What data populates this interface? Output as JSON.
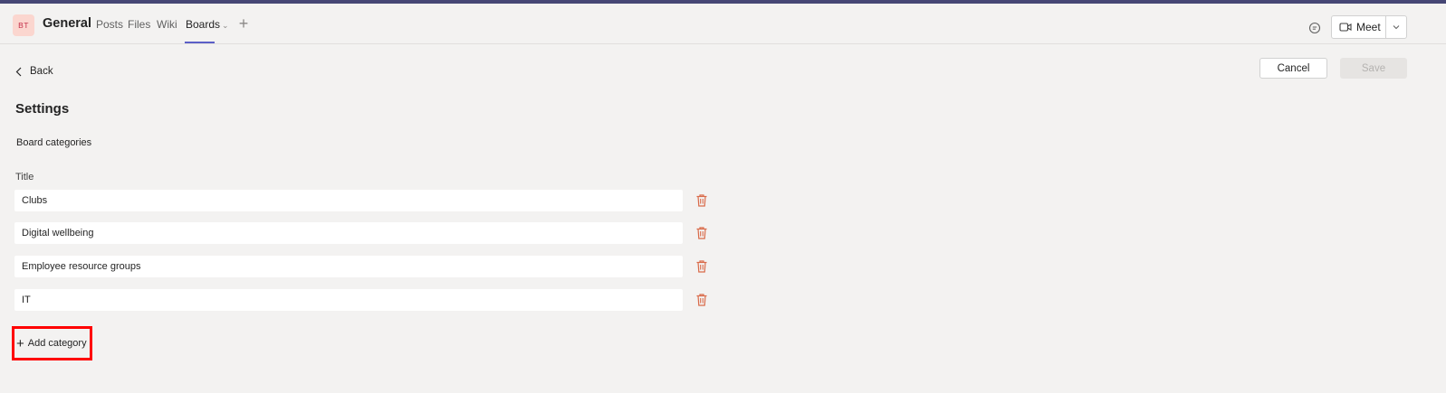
{
  "header": {
    "avatar_initials": "BT",
    "channel_title": "General",
    "tabs": [
      {
        "label": "Posts"
      },
      {
        "label": "Files"
      },
      {
        "label": "Wiki"
      },
      {
        "label": "Boards",
        "active": true
      }
    ],
    "meet_label": "Meet"
  },
  "toolbar": {
    "back_label": "Back",
    "cancel_label": "Cancel",
    "save_label": "Save"
  },
  "settings": {
    "title": "Settings",
    "section_label": "Board categories",
    "column_label": "Title",
    "categories": [
      {
        "value": "Clubs"
      },
      {
        "value": "Digital wellbeing"
      },
      {
        "value": "Employee resource groups"
      },
      {
        "value": "IT"
      }
    ],
    "add_label": "Add category"
  },
  "colors": {
    "accent": "#5b5fc7",
    "top_bar": "#464775",
    "trash": "#d96b4a",
    "highlight": "#ff0000"
  }
}
